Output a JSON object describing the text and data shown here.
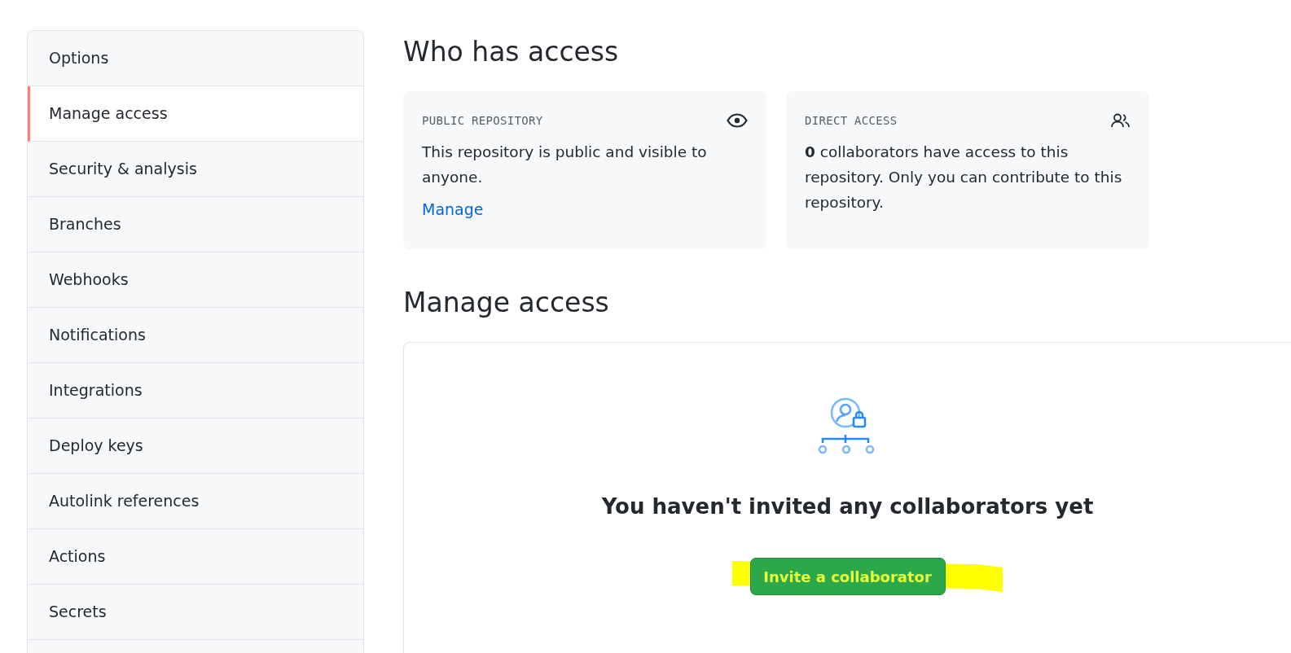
{
  "sidebar": {
    "items": [
      {
        "label": "Options",
        "selected": false
      },
      {
        "label": "Manage access",
        "selected": true
      },
      {
        "label": "Security & analysis",
        "selected": false
      },
      {
        "label": "Branches",
        "selected": false
      },
      {
        "label": "Webhooks",
        "selected": false
      },
      {
        "label": "Notifications",
        "selected": false
      },
      {
        "label": "Integrations",
        "selected": false
      },
      {
        "label": "Deploy keys",
        "selected": false
      },
      {
        "label": "Autolink references",
        "selected": false
      },
      {
        "label": "Actions",
        "selected": false
      },
      {
        "label": "Secrets",
        "selected": false
      }
    ]
  },
  "who_has_access": {
    "title": "Who has access",
    "cards": [
      {
        "kind": "public",
        "label": "PUBLIC REPOSITORY",
        "text": "This repository is public and visible to anyone.",
        "link": "Manage"
      },
      {
        "kind": "direct",
        "label": "DIRECT ACCESS",
        "text": "**0** collaborators have access to this repository. Only you can contribute to this repository."
      }
    ]
  },
  "manage_access": {
    "title": "Manage access",
    "empty_title": "You haven't invited any collaborators yet",
    "button": "Invite a collaborator"
  }
}
